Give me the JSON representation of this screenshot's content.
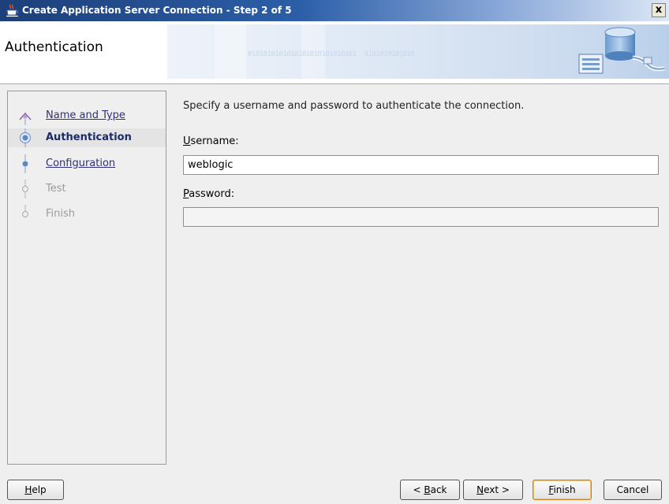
{
  "window": {
    "title": "Create Application Server Connection - Step 2 of 5",
    "close_glyph": "x",
    "icon": "java-cup-icon"
  },
  "header": {
    "title": "Authentication",
    "binary_text": "0101010101010101010101010101  0101010101010"
  },
  "steps": [
    {
      "label": "Name and Type",
      "state": "completed-link"
    },
    {
      "label": "Authentication",
      "state": "current"
    },
    {
      "label": "Configuration",
      "state": "link"
    },
    {
      "label": "Test",
      "state": "disabled"
    },
    {
      "label": "Finish",
      "state": "disabled"
    }
  ],
  "content": {
    "instruction": "Specify a username and password to authenticate the connection.",
    "username": {
      "label_accel": "U",
      "label_rest": "sername:",
      "value": "weblogic"
    },
    "password": {
      "label_accel": "P",
      "label_rest": "assword:",
      "value": ""
    }
  },
  "buttons": {
    "help": {
      "accel": "H",
      "rest": "elp"
    },
    "back": {
      "prefix": "< ",
      "accel": "B",
      "rest": "ack"
    },
    "next": {
      "accel": "N",
      "rest": "ext >"
    },
    "finish": {
      "accel": "F",
      "rest": "inish"
    },
    "cancel": {
      "label": "Cancel"
    }
  },
  "colors": {
    "titlebar_dark": "#1d3f7a",
    "link": "#30307a",
    "current_step": "#1a2a6a",
    "default_button_border": "#c77d1a"
  }
}
